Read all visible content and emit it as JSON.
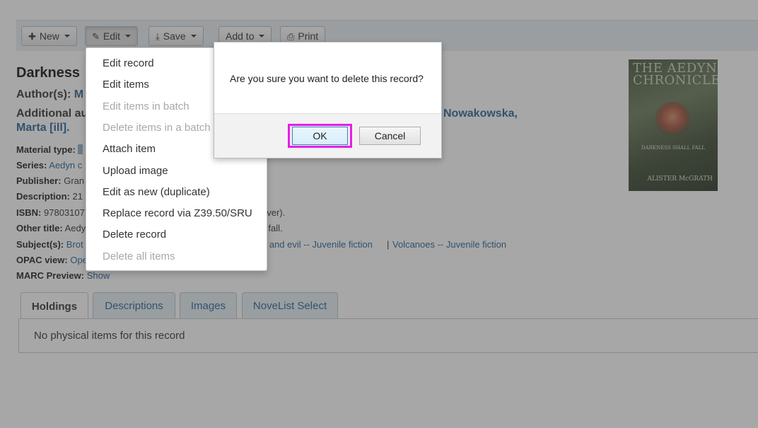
{
  "toolbar": {
    "new_label": "New",
    "edit_label": "Edit",
    "save_label": "Save",
    "addto_label": "Add to",
    "print_label": "Print"
  },
  "record": {
    "title": "Darkness",
    "authors_label": "Author(s):",
    "authors_value": "M",
    "additional_label": "Additional au",
    "additional_right": "Nowakowska,",
    "additional_line2": "Marta [ill].",
    "material_type_label": "Material type:",
    "series_label": "Series:",
    "series_value": "Aedyn c",
    "publisher_label": "Publisher:",
    "publisher_value": "Gran",
    "description_label": "Description:",
    "description_value": "21",
    "isbn_label": "ISBN:",
    "isbn_value": "97803107",
    "isbn_right": "over).",
    "other_title_label": "Other title:",
    "other_title_value": "Aedy",
    "other_title_right": "ll fall.",
    "subjects_label": "Subject(s):",
    "subjects_value": "Brot",
    "subjects_right_1": "d and evil -- Juvenile fiction",
    "subjects_sep": "|",
    "subjects_right_2": "Volcanoes -- Juvenile fiction",
    "opac_label": "OPAC view:",
    "opac_value": "Ope",
    "marc_label": "MARC Preview:",
    "marc_value": "Show"
  },
  "cover": {
    "title_text": "THE AEDYN CHRONICLES",
    "subtitle": "DARKNESS SHALL FALL",
    "author": "ALISTER McGRATH"
  },
  "edit_menu": {
    "items": [
      {
        "label": "Edit record",
        "disabled": false
      },
      {
        "label": "Edit items",
        "disabled": false
      },
      {
        "label": "Edit items in batch",
        "disabled": true
      },
      {
        "label": "Delete items in a batch",
        "disabled": true
      },
      {
        "label": "Attach item",
        "disabled": false
      },
      {
        "label": "Upload image",
        "disabled": false
      },
      {
        "label": "Edit as new (duplicate)",
        "disabled": false
      },
      {
        "label": "Replace record via Z39.50/SRU",
        "disabled": false
      },
      {
        "label": "Delete record",
        "disabled": false
      },
      {
        "label": "Delete all items",
        "disabled": true
      }
    ]
  },
  "tabs": [
    {
      "label": "Holdings",
      "active": true
    },
    {
      "label": "Descriptions",
      "active": false
    },
    {
      "label": "Images",
      "active": false
    },
    {
      "label": "NoveList Select",
      "active": false
    }
  ],
  "holdings_message": "No physical items for this record",
  "dialog": {
    "message": "Are you sure you want to delete this record?",
    "ok_label": "OK",
    "cancel_label": "Cancel"
  },
  "colors": {
    "link": "#2a6496",
    "highlight": "#e81ee8"
  }
}
